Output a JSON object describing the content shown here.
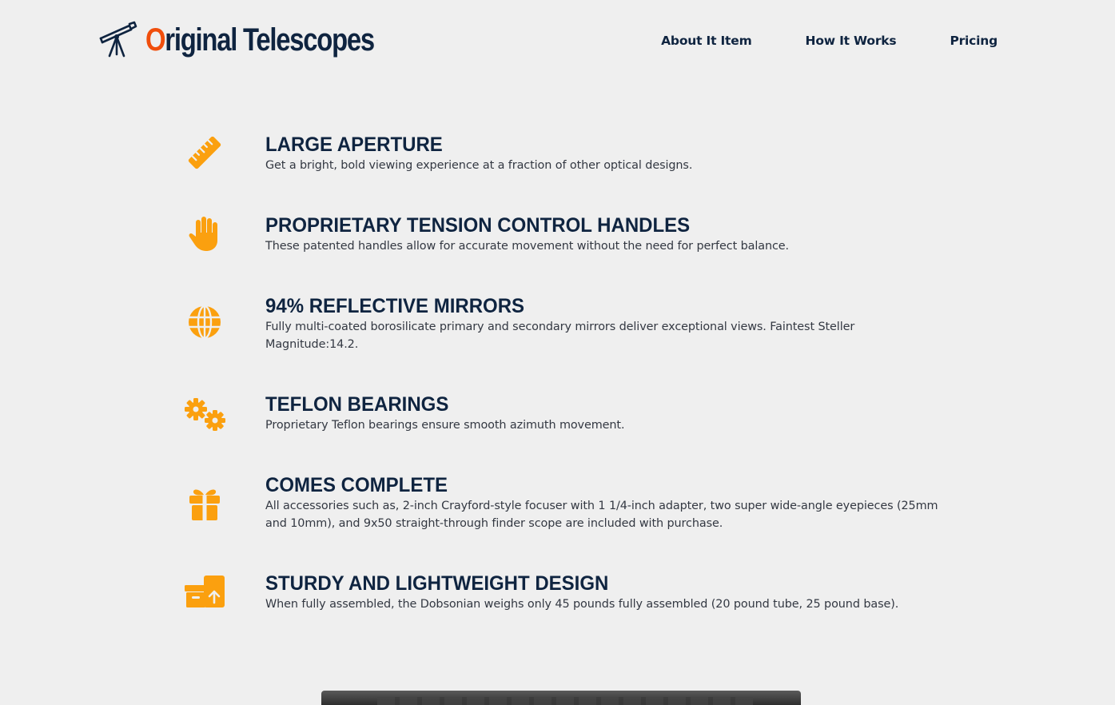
{
  "brand": {
    "first_letter": "O",
    "rest": "riginal Telescopes",
    "accent_color": "#f04e0c",
    "text_color": "#0f2440"
  },
  "nav": {
    "items": [
      {
        "label": "About It Item"
      },
      {
        "label": "How It Works"
      },
      {
        "label": "Pricing"
      }
    ]
  },
  "icon_color": "#fba00f",
  "features": [
    {
      "icon": "ruler-icon",
      "title": "LARGE APERTURE",
      "desc": "Get a bright, bold viewing experience at a fraction of other optical designs."
    },
    {
      "icon": "hand-icon",
      "title": "PROPRIETARY TENSION CONTROL HANDLES",
      "desc": "These patented handles allow for accurate movement without the need for perfect balance."
    },
    {
      "icon": "globe-icon",
      "title": "94% REFLECTIVE MIRRORS",
      "desc": "Fully multi-coated borosilicate primary and secondary mirrors deliver exceptional views. Faintest Steller Magnitude:14.2."
    },
    {
      "icon": "gears-icon",
      "title": "TEFLON BEARINGS",
      "desc": "Proprietary Teflon bearings ensure smooth azimuth movement."
    },
    {
      "icon": "gift-icon",
      "title": "COMES COMPLETE",
      "desc": "All accessories such as, 2-inch Crayford-style focuser with 1 1/4-inch adapter, two super wide-angle eyepieces (25mm and 10mm), and 9x50 straight-through finder scope are included with purchase."
    },
    {
      "icon": "box-upload-icon",
      "title": "STURDY AND LIGHTWEIGHT DESIGN",
      "desc": "When fully assembled, the Dobsonian weighs only 45 pounds fully assembled (20 pound tube, 25 pound base)."
    }
  ]
}
